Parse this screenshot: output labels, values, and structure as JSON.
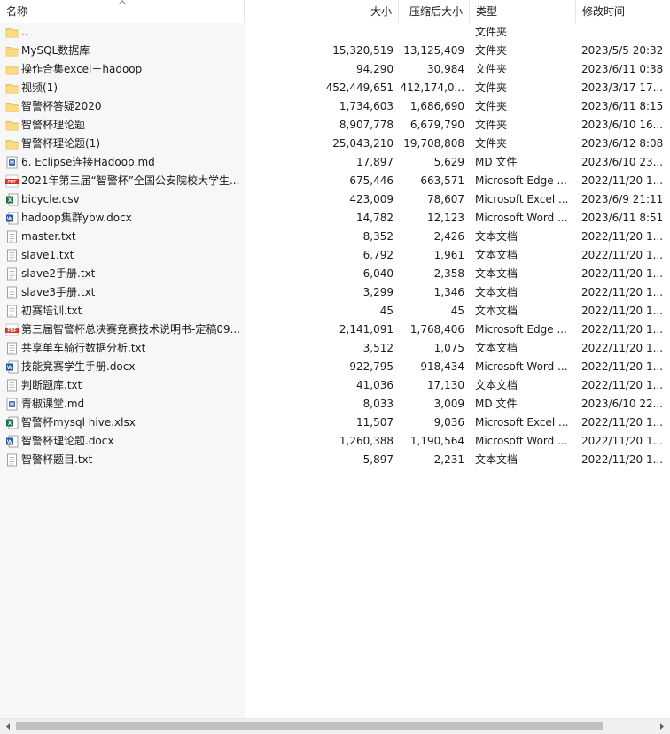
{
  "columns": {
    "name": "名称",
    "size": "大小",
    "packed": "压缩后大小",
    "type": "类型",
    "modified": "修改时间"
  },
  "colors": {
    "folder": "#f8d775",
    "word": "#2b579a",
    "excel": "#217346",
    "pdf": "#d93025",
    "md": "#3f6fb5"
  },
  "files": [
    {
      "icon": "folder-icon",
      "name": "..",
      "size": "",
      "packed": "",
      "type": "文件夹",
      "modified": ""
    },
    {
      "icon": "folder-icon",
      "name": "MySQL数据库",
      "size": "15,320,519",
      "packed": "13,125,409",
      "type": "文件夹",
      "modified": "2023/5/5 20:32"
    },
    {
      "icon": "folder-icon",
      "name": "操作合集excel＋hadoop",
      "size": "94,290",
      "packed": "30,984",
      "type": "文件夹",
      "modified": "2023/6/11 0:38"
    },
    {
      "icon": "folder-icon",
      "name": "视频(1)",
      "size": "452,449,651",
      "packed": "412,174,0...",
      "type": "文件夹",
      "modified": "2023/3/17 17..."
    },
    {
      "icon": "folder-icon",
      "name": "智警杯答疑2020",
      "size": "1,734,603",
      "packed": "1,686,690",
      "type": "文件夹",
      "modified": "2023/6/11 8:15"
    },
    {
      "icon": "folder-icon",
      "name": "智警杯理论题",
      "size": "8,907,778",
      "packed": "6,679,790",
      "type": "文件夹",
      "modified": "2023/6/10 16..."
    },
    {
      "icon": "folder-icon",
      "name": "智警杯理论题(1)",
      "size": "25,043,210",
      "packed": "19,708,808",
      "type": "文件夹",
      "modified": "2023/6/12 8:08"
    },
    {
      "icon": "md-file-icon",
      "name": "6. Eclipse连接Hadoop.md",
      "size": "17,897",
      "packed": "5,629",
      "type": "MD 文件",
      "modified": "2023/6/10 23..."
    },
    {
      "icon": "pdf-file-icon",
      "name": "2021年第三届“智警杯”全国公安院校大学生...",
      "size": "675,446",
      "packed": "663,571",
      "type": "Microsoft Edge ...",
      "modified": "2022/11/20 1..."
    },
    {
      "icon": "excel-file-icon",
      "name": "bicycle.csv",
      "size": "423,009",
      "packed": "78,607",
      "type": "Microsoft Excel ...",
      "modified": "2023/6/9 21:11"
    },
    {
      "icon": "word-file-icon",
      "name": "hadoop集群ybw.docx",
      "size": "14,782",
      "packed": "12,123",
      "type": "Microsoft Word ...",
      "modified": "2023/6/11 8:51"
    },
    {
      "icon": "text-file-icon",
      "name": "master.txt",
      "size": "8,352",
      "packed": "2,426",
      "type": "文本文档",
      "modified": "2022/11/20 1..."
    },
    {
      "icon": "text-file-icon",
      "name": "slave1.txt",
      "size": "6,792",
      "packed": "1,961",
      "type": "文本文档",
      "modified": "2022/11/20 1..."
    },
    {
      "icon": "text-file-icon",
      "name": "slave2手册.txt",
      "size": "6,040",
      "packed": "2,358",
      "type": "文本文档",
      "modified": "2022/11/20 1..."
    },
    {
      "icon": "text-file-icon",
      "name": "slave3手册.txt",
      "size": "3,299",
      "packed": "1,346",
      "type": "文本文档",
      "modified": "2022/11/20 1..."
    },
    {
      "icon": "text-file-icon",
      "name": "初赛培训.txt",
      "size": "45",
      "packed": "45",
      "type": "文本文档",
      "modified": "2022/11/20 1..."
    },
    {
      "icon": "pdf-file-icon",
      "name": "第三届智警杯总决赛竞赛技术说明书-定稿09...",
      "size": "2,141,091",
      "packed": "1,768,406",
      "type": "Microsoft Edge ...",
      "modified": "2022/11/20 1..."
    },
    {
      "icon": "text-file-icon",
      "name": "共享单车骑行数据分析.txt",
      "size": "3,512",
      "packed": "1,075",
      "type": "文本文档",
      "modified": "2022/11/20 1..."
    },
    {
      "icon": "word-file-icon",
      "name": "技能竞赛学生手册.docx",
      "size": "922,795",
      "packed": "918,434",
      "type": "Microsoft Word ...",
      "modified": "2022/11/20 1..."
    },
    {
      "icon": "text-file-icon",
      "name": "判断题库.txt",
      "size": "41,036",
      "packed": "17,130",
      "type": "文本文档",
      "modified": "2022/11/20 1..."
    },
    {
      "icon": "md-file-icon",
      "name": "青椒课堂.md",
      "size": "8,033",
      "packed": "3,009",
      "type": "MD 文件",
      "modified": "2023/6/10 22..."
    },
    {
      "icon": "excel-file-icon",
      "name": "智警杯mysql  hive.xlsx",
      "size": "11,507",
      "packed": "9,036",
      "type": "Microsoft Excel ...",
      "modified": "2022/11/20 1..."
    },
    {
      "icon": "word-file-icon",
      "name": "智警杯理论题.docx",
      "size": "1,260,388",
      "packed": "1,190,564",
      "type": "Microsoft Word ...",
      "modified": "2022/11/20 1..."
    },
    {
      "icon": "text-file-icon",
      "name": "智警杯题目.txt",
      "size": "5,897",
      "packed": "2,231",
      "type": "文本文档",
      "modified": "2022/11/20 1..."
    }
  ]
}
